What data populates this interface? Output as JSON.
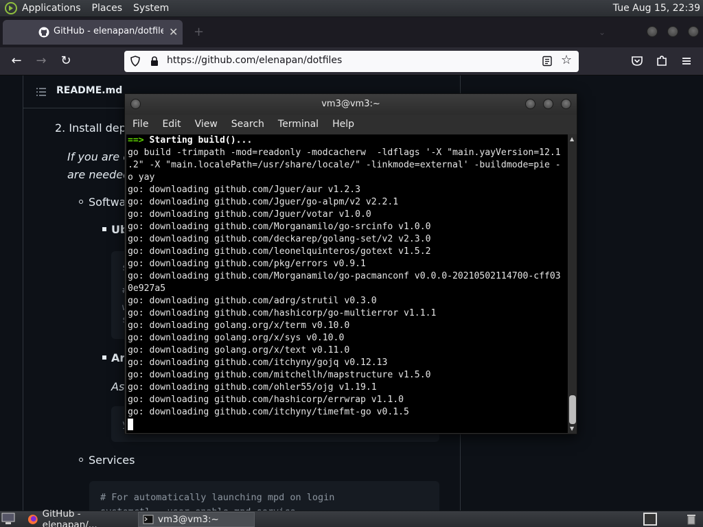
{
  "top_panel": {
    "menus": [
      "Applications",
      "Places",
      "System"
    ],
    "clock": "Tue Aug 15, 22:39"
  },
  "browser": {
    "tab_title": "GitHub - elenapan/dotfiles:",
    "tab_close": "✕",
    "new_tab": "+",
    "url": "https://github.com/elenapan/dotfiles"
  },
  "readme": {
    "filename": "README.md",
    "step_2": "2. Install depen",
    "italic_line_1": "If you are cu",
    "italic_line_2": "are needed.",
    "software": "Software",
    "ubuntu": "Ub",
    "code_frag_1": "s",
    "code_frag_2": "#",
    "code_frag_3": "w",
    "code_frag_4": "s",
    "arch": "Arc",
    "as_text": "As",
    "code_frag_5": "y",
    "services": "Services",
    "comment": "# For automatically launching mpd on login",
    "comment_2": "systemctl --user enable mpd.service"
  },
  "terminal": {
    "title": "vm3@vm3:~",
    "menu": [
      "File",
      "Edit",
      "View",
      "Search",
      "Terminal",
      "Help"
    ],
    "arrow": "==>",
    "starting": "Starting build()...",
    "lines": [
      "go build -trimpath -mod=readonly -modcacherw  -ldflags '-X \"main.yayVersion=12.1",
      ".2\" -X \"main.localePath=/usr/share/locale/\" -linkmode=external' -buildmode=pie -",
      "o yay",
      "go: downloading github.com/Jguer/aur v1.2.3",
      "go: downloading github.com/Jguer/go-alpm/v2 v2.2.1",
      "go: downloading github.com/Jguer/votar v1.0.0",
      "go: downloading github.com/Morganamilo/go-srcinfo v1.0.0",
      "go: downloading github.com/deckarep/golang-set/v2 v2.3.0",
      "go: downloading github.com/leonelquinteros/gotext v1.5.2",
      "go: downloading github.com/pkg/errors v0.9.1",
      "go: downloading github.com/Morganamilo/go-pacmanconf v0.0.0-20210502114700-cff03",
      "0e927a5",
      "go: downloading github.com/adrg/strutil v0.3.0",
      "go: downloading github.com/hashicorp/go-multierror v1.1.1",
      "go: downloading golang.org/x/term v0.10.0",
      "go: downloading golang.org/x/sys v0.10.0",
      "go: downloading golang.org/x/text v0.11.0",
      "go: downloading github.com/itchyny/gojq v0.12.13",
      "go: downloading github.com/mitchellh/mapstructure v1.5.0",
      "go: downloading github.com/ohler55/ojg v1.19.1",
      "go: downloading github.com/hashicorp/errwrap v1.1.0",
      "go: downloading github.com/itchyny/timefmt-go v0.1.5"
    ]
  },
  "taskbar": {
    "task_1": "GitHub - elenapan/...",
    "task_2": "vm3@vm3:~"
  }
}
